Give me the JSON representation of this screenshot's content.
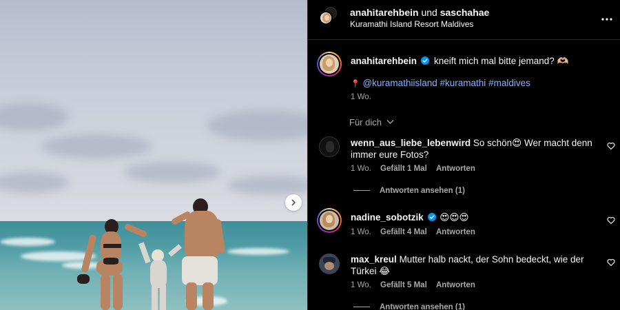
{
  "header": {
    "user1": "anahitarehbein",
    "conjunction": "und",
    "user2": "saschahae",
    "location": "Kuramathi Island Resort Maldives",
    "more_icon": "more-horizontal-icon"
  },
  "caption": {
    "username": "anahitarehbein",
    "text": "kneift mich mal bitte jemand? 🫶🏼",
    "tags": [
      "@kuramathiisland",
      "#kuramathi",
      "#maldives"
    ],
    "time": "1 Wo."
  },
  "filter": {
    "label": "Für dich",
    "icon": "chevron-down-icon"
  },
  "comments": [
    {
      "username": "wenn_aus_liebe_lebenwird",
      "text": "So schön😍 Wer macht denn",
      "text_line2": "immer eure Fotos?",
      "time": "1 Wo.",
      "likes": "Gefällt 1 Mal",
      "reply": "Antworten",
      "view_replies": "Antworten ansehen (1)"
    },
    {
      "username": "nadine_sobotzik",
      "text": "😍😍😍",
      "time": "1 Wo.",
      "likes": "Gefällt 4 Mal",
      "reply": "Antworten"
    },
    {
      "username": "max_kreul",
      "text": "Mutter halb nackt, der Sohn bedeckt, wie der",
      "text_line2": "Türkei 😂",
      "time": "1 Wo.",
      "likes": "Gefällt 5 Mal",
      "reply": "Antworten",
      "view_replies": "Antworten ansehen (1)"
    }
  ],
  "colors": {
    "background": "#000000",
    "link": "#8ab4f8",
    "muted": "#a8a8a8",
    "verified": "#0095f6"
  }
}
